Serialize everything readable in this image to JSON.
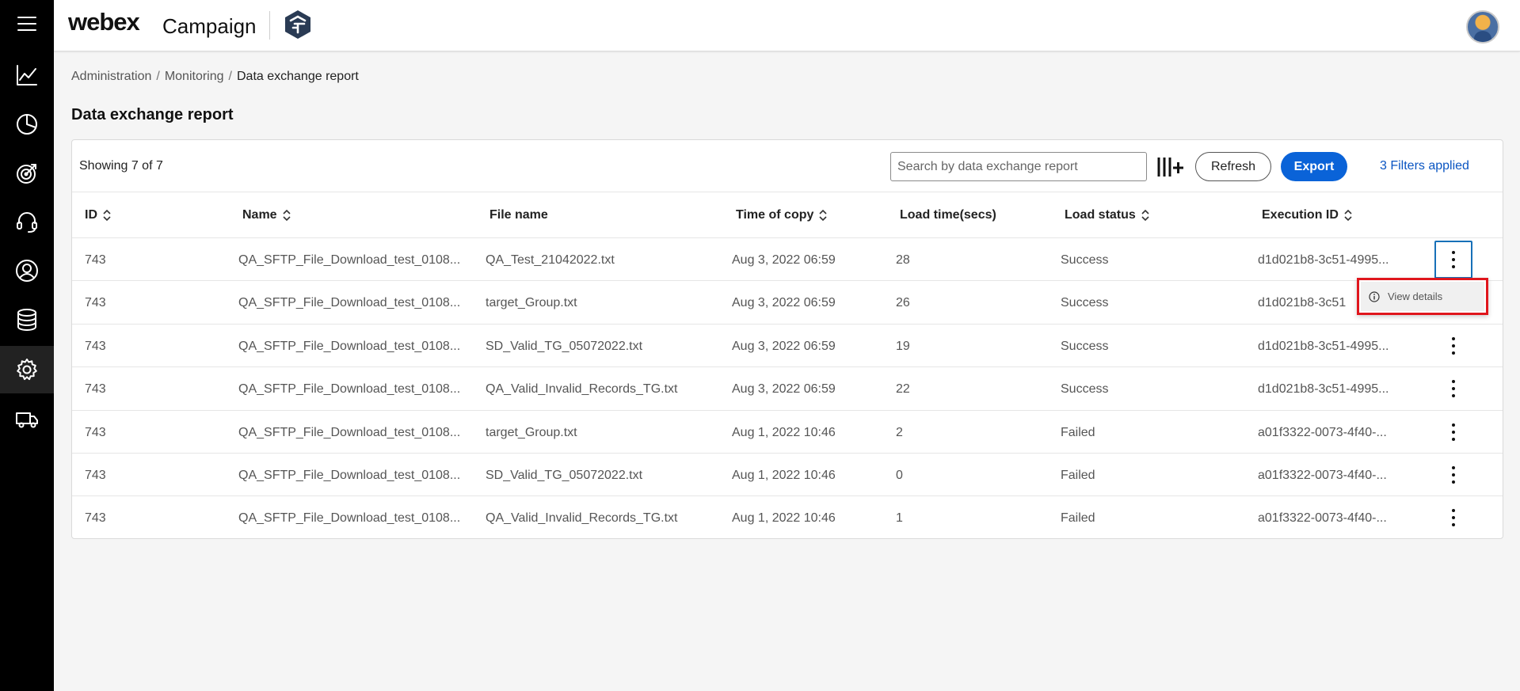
{
  "header": {
    "brand": "webex",
    "product": "Campaign"
  },
  "nav": {
    "items": [
      "menu-icon",
      "analytics-icon",
      "pie-chart-icon",
      "target-icon",
      "headset-icon",
      "user-icon",
      "database-icon",
      "settings-icon",
      "delivery-truck-icon"
    ],
    "active": "settings-icon"
  },
  "breadcrumb": {
    "items": [
      "Administration",
      "Monitoring",
      "Data exchange report"
    ],
    "separator": "/"
  },
  "page": {
    "title": "Data exchange report"
  },
  "toolbar": {
    "showing": "Showing 7 of 7",
    "search_placeholder": "Search by data exchange report",
    "refresh_label": "Refresh",
    "export_label": "Export",
    "filters_label": "3 Filters applied"
  },
  "table": {
    "columns": [
      "ID",
      "Name",
      "File name",
      "Time of copy",
      "Load time(secs)",
      "Load status",
      "Execution ID"
    ],
    "rows": [
      {
        "id": "743",
        "name": "QA_SFTP_File_Download_test_0108...",
        "file": "QA_Test_21042022.txt",
        "time": "Aug 3, 2022 06:59",
        "load_time": "28",
        "status": "Success",
        "exec_id": "d1d021b8-3c51-4995..."
      },
      {
        "id": "743",
        "name": "QA_SFTP_File_Download_test_0108...",
        "file": "target_Group.txt",
        "time": "Aug 3, 2022 06:59",
        "load_time": "26",
        "status": "Success",
        "exec_id": "d1d021b8-3c51"
      },
      {
        "id": "743",
        "name": "QA_SFTP_File_Download_test_0108...",
        "file": "SD_Valid_TG_05072022.txt",
        "time": "Aug 3, 2022 06:59",
        "load_time": "19",
        "status": "Success",
        "exec_id": "d1d021b8-3c51-4995..."
      },
      {
        "id": "743",
        "name": "QA_SFTP_File_Download_test_0108...",
        "file": "QA_Valid_Invalid_Records_TG.txt",
        "time": "Aug 3, 2022 06:59",
        "load_time": "22",
        "status": "Success",
        "exec_id": "d1d021b8-3c51-4995..."
      },
      {
        "id": "743",
        "name": "QA_SFTP_File_Download_test_0108...",
        "file": "target_Group.txt",
        "time": "Aug 1, 2022 10:46",
        "load_time": "2",
        "status": "Failed",
        "exec_id": "a01f3322-0073-4f40-..."
      },
      {
        "id": "743",
        "name": "QA_SFTP_File_Download_test_0108...",
        "file": "SD_Valid_TG_05072022.txt",
        "time": "Aug 1, 2022 10:46",
        "load_time": "0",
        "status": "Failed",
        "exec_id": "a01f3322-0073-4f40-..."
      },
      {
        "id": "743",
        "name": "QA_SFTP_File_Download_test_0108...",
        "file": "QA_Valid_Invalid_Records_TG.txt",
        "time": "Aug 1, 2022 10:46",
        "load_time": "1",
        "status": "Failed",
        "exec_id": "a01f3322-0073-4f40-..."
      }
    ]
  },
  "menu": {
    "view_details": "View details"
  },
  "colors": {
    "nav_bg": "#000000",
    "accent": "#0a63d8",
    "link": "#0a55c2",
    "highlight": "#e0161d"
  }
}
